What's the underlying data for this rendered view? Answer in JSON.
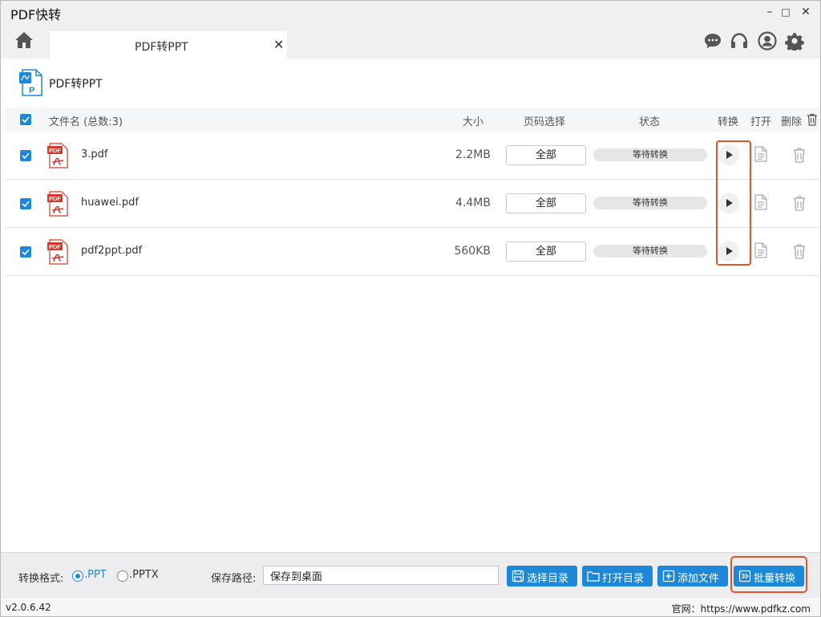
{
  "app": {
    "title": "PDF快转"
  },
  "window_controls": {
    "minimize": "–",
    "maximize": "□",
    "close": "✕"
  },
  "tab": {
    "label": "PDF转PPT",
    "close": "✕"
  },
  "top_icons": [
    "chat-icon",
    "headset-icon",
    "user-icon",
    "settings-icon"
  ],
  "page": {
    "title": "PDF转PPT"
  },
  "table": {
    "headers": {
      "filename": "文件名 (总数:3)",
      "size": "大小",
      "pages": "页码选择",
      "status": "状态",
      "convert": "转换",
      "open": "打开",
      "delete": "删除"
    },
    "rows": [
      {
        "name": "3.pdf",
        "size": "2.2MB",
        "pages": "全部",
        "status": "等待转换",
        "checked": true
      },
      {
        "name": "huawei.pdf",
        "size": "4.4MB",
        "pages": "全部",
        "status": "等待转换",
        "checked": true
      },
      {
        "name": "pdf2ppt.pdf",
        "size": "560KB",
        "pages": "全部",
        "status": "等待转换",
        "checked": true
      }
    ]
  },
  "bottom": {
    "format_label": "转换格式:",
    "formats": [
      {
        "label": ".PPT",
        "selected": true
      },
      {
        "label": ".PPTX",
        "selected": false
      }
    ],
    "path_label": "保存路径:",
    "path_value": "保存到桌面",
    "buttons": {
      "choose_dir": "选择目录",
      "open_dir": "打开目录",
      "add_file": "添加文件",
      "batch_convert": "批量转换"
    }
  },
  "footer": {
    "version": "v2.0.6.42",
    "website": "官网：https://www.pdfkz.com"
  },
  "colors": {
    "accent": "#1e88d8",
    "highlight": "#e0562a",
    "pdf_red": "#d9372b"
  }
}
